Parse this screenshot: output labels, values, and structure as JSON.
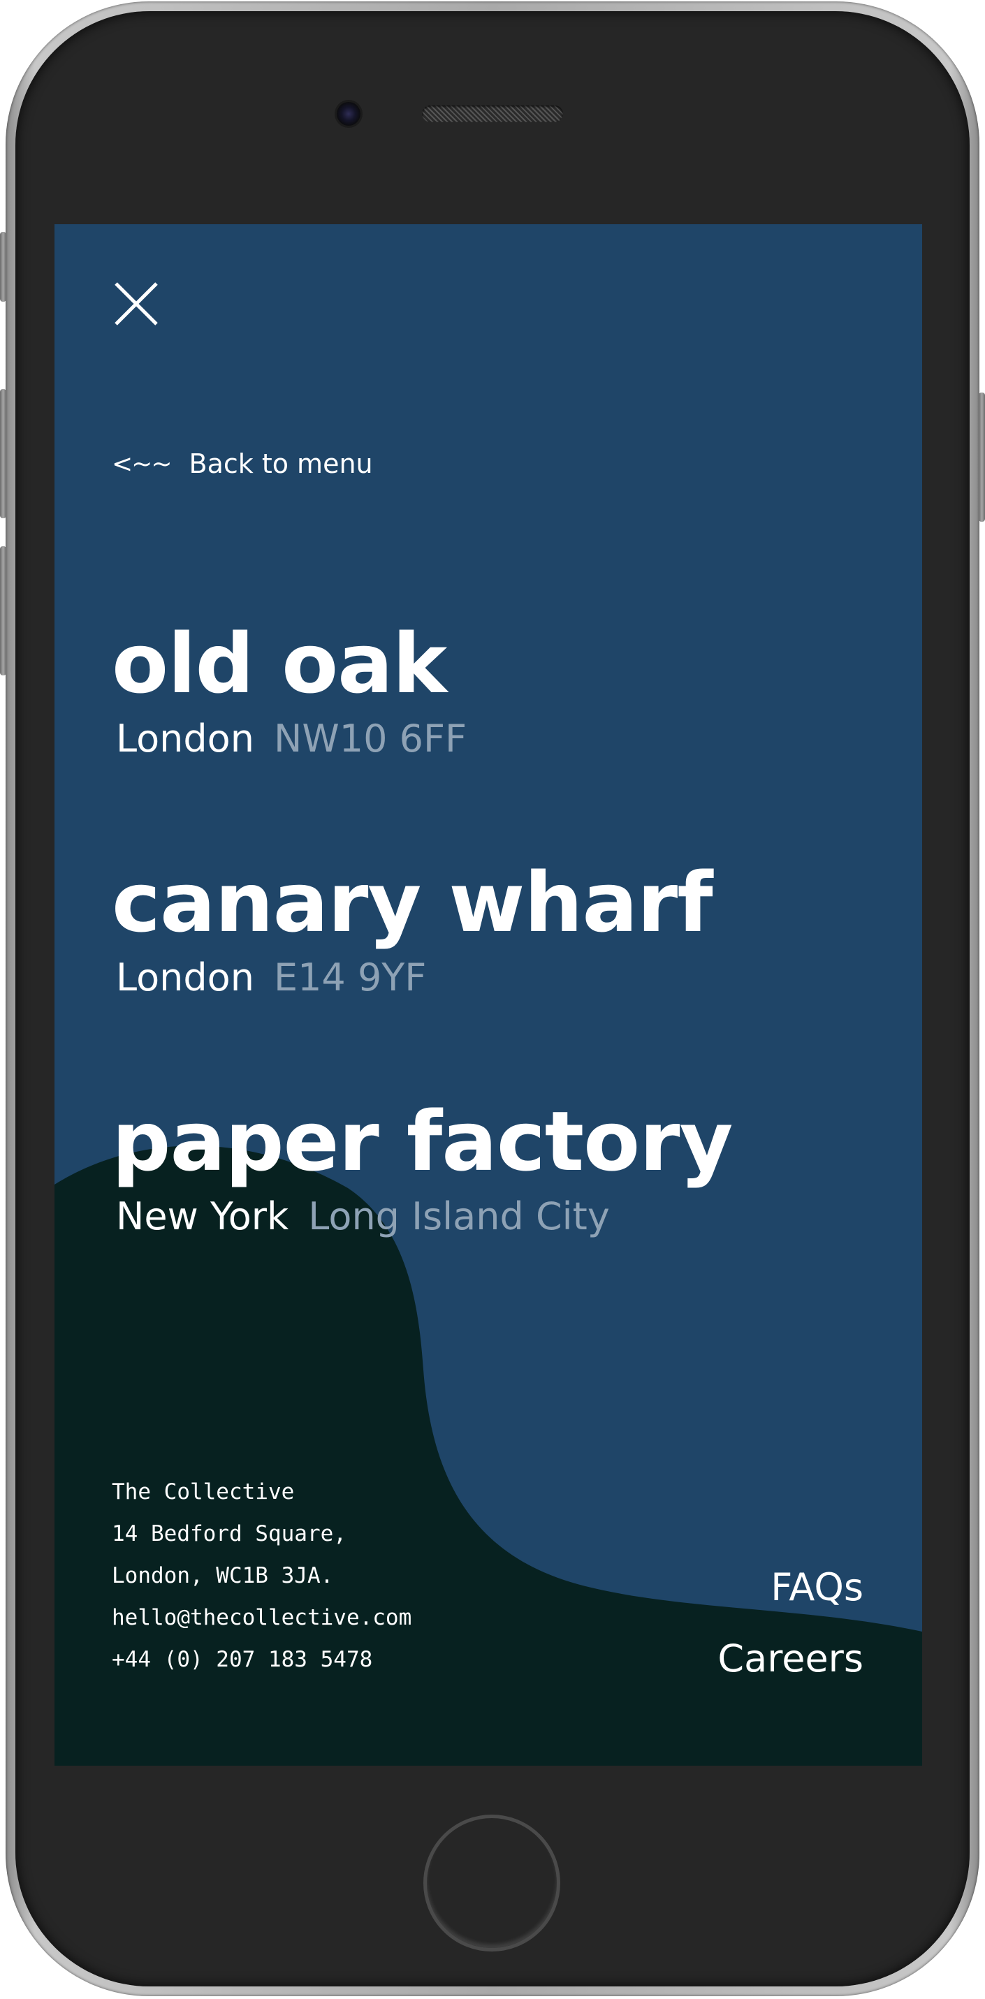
{
  "theme": {
    "background": "#1f4568",
    "dark_shape": "#072120",
    "muted_text": "#8ea2b5",
    "text": "#ffffff"
  },
  "icons": {
    "close": "close-icon",
    "back": "back-arrow-icon"
  },
  "nav": {
    "back_arrow": "<~~",
    "back_label": "Back to menu"
  },
  "locations": [
    {
      "name": "old oak",
      "city": "London",
      "area": "NW10 6FF"
    },
    {
      "name": "canary wharf",
      "city": "London",
      "area": "E14 9YF"
    },
    {
      "name": "paper factory",
      "city": "New York",
      "area": "Long Island City"
    }
  ],
  "footer": {
    "address": {
      "company": "The Collective",
      "line1": "14 Bedford Square,",
      "line2": "London, WC1B 3JA.",
      "email": "hello@thecollective.com",
      "phone": "+44 (0) 207 183 5478"
    },
    "links": [
      "FAQs",
      "Careers"
    ]
  }
}
